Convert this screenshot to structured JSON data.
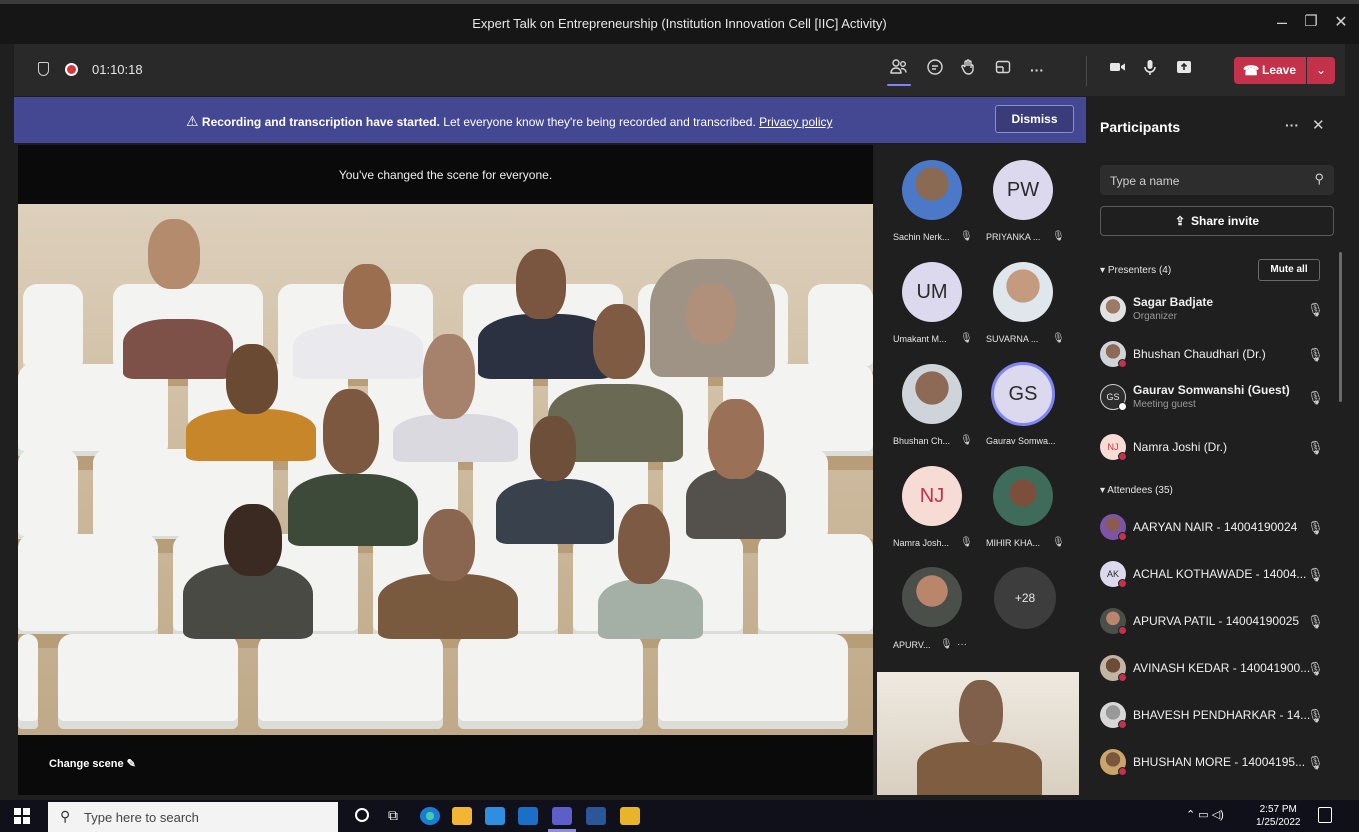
{
  "window": {
    "title": "Expert Talk on Entrepreneurship (Institution Innovation Cell [IIC] Activity)",
    "minimize": "–",
    "maximize": "❐",
    "close": "✕"
  },
  "toolbar": {
    "elapsed": "01:10:18",
    "leave_label": "Leave",
    "caret": "⌄"
  },
  "banner": {
    "bold": "Recording and transcription have started.",
    "text": " Let everyone know they're being recorded and transcribed. ",
    "link": "Privacy policy",
    "dismiss": "Dismiss",
    "icon": "⚠"
  },
  "stage": {
    "scene_note": "You've changed the scene for everyone.",
    "change_scene": "Change scene"
  },
  "gallery": {
    "tiles": [
      {
        "name": "Sachin Nerk...",
        "initials": ""
      },
      {
        "name": "PRIYANKA ...",
        "initials": "PW"
      },
      {
        "name": "Umakant M...",
        "initials": "UM"
      },
      {
        "name": "SUVARNA ...",
        "initials": ""
      },
      {
        "name": "Bhushan Ch...",
        "initials": ""
      },
      {
        "name": "Gaurav Somwa...",
        "initials": "GS"
      },
      {
        "name": "Namra Josh...",
        "initials": "NJ"
      },
      {
        "name": "MIHIR KHA...",
        "initials": ""
      },
      {
        "name": "APURV...",
        "initials": ""
      }
    ],
    "overflow": "+28"
  },
  "participants": {
    "title": "Participants",
    "search_placeholder": "Type a name",
    "share_invite": "Share invite",
    "presenters_label": "Presenters (4)",
    "mute_all": "Mute all",
    "attendees_label": "Attendees (35)",
    "presenters": [
      {
        "name": "Sagar Badjate",
        "role": "Organizer",
        "initials": ""
      },
      {
        "name": "Bhushan Chaudhari (Dr.)",
        "role": "",
        "initials": ""
      },
      {
        "name": "Gaurav Somwanshi (Guest)",
        "role": "Meeting guest",
        "initials": "GS"
      },
      {
        "name": "Namra Joshi (Dr.)",
        "role": "",
        "initials": "NJ"
      }
    ],
    "attendees": [
      {
        "name": "AARYAN NAIR - 14004190024",
        "initials": ""
      },
      {
        "name": "ACHAL KOTHAWADE - 14004...",
        "initials": "AK"
      },
      {
        "name": "APURVA PATIL - 14004190025",
        "initials": ""
      },
      {
        "name": "AVINASH KEDAR - 140041900...",
        "initials": ""
      },
      {
        "name": "BHAVESH PENDHARKAR - 14...",
        "initials": ""
      },
      {
        "name": "BHUSHAN MORE - 14004195...",
        "initials": ""
      }
    ]
  },
  "taskbar": {
    "search_placeholder": "Type here to search",
    "time": "2:57 PM",
    "date": "1/25/2022"
  }
}
